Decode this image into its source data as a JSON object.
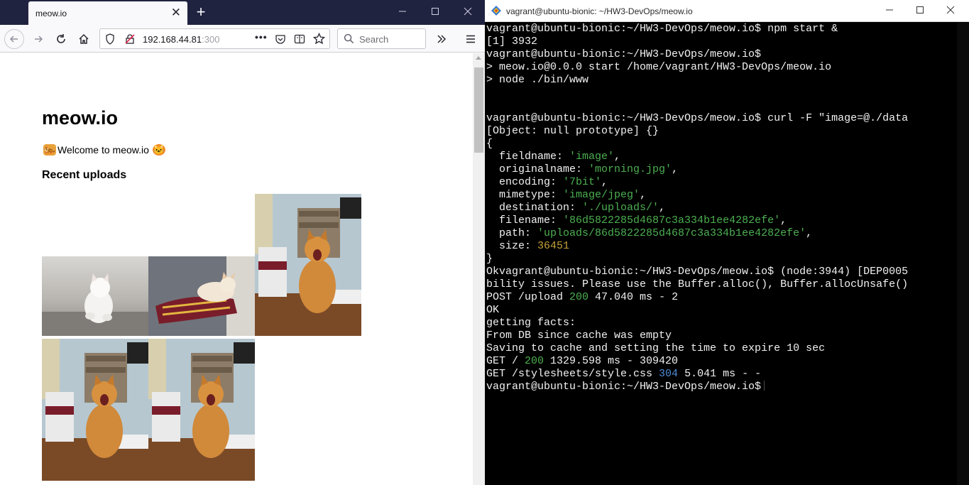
{
  "browser": {
    "tab_title": "meow.io",
    "tab_close": "✕",
    "new_tab": "+",
    "url_host": "192.168.44.81",
    "url_port": ":300",
    "search_placeholder": "Search",
    "page": {
      "title": "meow.io",
      "welcome": "Welcome to meow.io",
      "recent_heading": "Recent uploads"
    }
  },
  "terminal": {
    "window_title": "vagrant@ubuntu-bionic: ~/HW3-DevOps/meow.io",
    "lines": [
      [
        {
          "t": "vagrant@ubuntu-bionic:~/HW3-DevOps/meow.io$ npm start &"
        }
      ],
      [
        {
          "t": "[1] 3932"
        }
      ],
      [
        {
          "t": "vagrant@ubuntu-bionic:~/HW3-DevOps/meow.io$"
        }
      ],
      [
        {
          "t": "> meow.io@0.0.0 start /home/vagrant/HW3-DevOps/meow.io"
        }
      ],
      [
        {
          "t": "> node ./bin/www"
        }
      ],
      [
        {
          "t": ""
        }
      ],
      [
        {
          "t": ""
        }
      ],
      [
        {
          "t": "vagrant@ubuntu-bionic:~/HW3-DevOps/meow.io$ curl -F \"image=@./data"
        }
      ],
      [
        {
          "t": "[Object: null prototype] {}"
        }
      ],
      [
        {
          "t": "{"
        }
      ],
      [
        {
          "t": "  fieldname: "
        },
        {
          "t": "'image'",
          "c": "g"
        },
        {
          "t": ","
        }
      ],
      [
        {
          "t": "  originalname: "
        },
        {
          "t": "'morning.jpg'",
          "c": "g"
        },
        {
          "t": ","
        }
      ],
      [
        {
          "t": "  encoding: "
        },
        {
          "t": "'7bit'",
          "c": "g"
        },
        {
          "t": ","
        }
      ],
      [
        {
          "t": "  mimetype: "
        },
        {
          "t": "'image/jpeg'",
          "c": "g"
        },
        {
          "t": ","
        }
      ],
      [
        {
          "t": "  destination: "
        },
        {
          "t": "'./uploads/'",
          "c": "g"
        },
        {
          "t": ","
        }
      ],
      [
        {
          "t": "  filename: "
        },
        {
          "t": "'86d5822285d4687c3a334b1ee4282efe'",
          "c": "g"
        },
        {
          "t": ","
        }
      ],
      [
        {
          "t": "  path: "
        },
        {
          "t": "'uploads/86d5822285d4687c3a334b1ee4282efe'",
          "c": "g"
        },
        {
          "t": ","
        }
      ],
      [
        {
          "t": "  size: "
        },
        {
          "t": "36451",
          "c": "y"
        }
      ],
      [
        {
          "t": "}"
        }
      ],
      [
        {
          "t": "Okvagrant@ubuntu-bionic:~/HW3-DevOps/meow.io$ (node:3944) [DEP0005"
        }
      ],
      [
        {
          "t": "bility issues. Please use the Buffer.alloc(), Buffer.allocUnsafe()"
        }
      ],
      [
        {
          "t": "POST /upload "
        },
        {
          "t": "200",
          "c": "g"
        },
        {
          "t": " 47.040 ms - 2"
        }
      ],
      [
        {
          "t": "OK"
        }
      ],
      [
        {
          "t": "getting facts:"
        }
      ],
      [
        {
          "t": "From DB since cache was empty"
        }
      ],
      [
        {
          "t": "Saving to cache and setting the time to expire 10 sec"
        }
      ],
      [
        {
          "t": "GET / "
        },
        {
          "t": "200",
          "c": "g"
        },
        {
          "t": " 1329.598 ms - 309420"
        }
      ],
      [
        {
          "t": "GET /stylesheets/style.css "
        },
        {
          "t": "304",
          "c": "b"
        },
        {
          "t": " 5.041 ms - -"
        }
      ],
      [
        {
          "t": "vagrant@ubuntu-bionic:~/HW3-DevOps/meow.io$",
          "cursor": true
        }
      ]
    ]
  },
  "colors": {
    "tabbar": "#202340",
    "terminal_bg": "#000000",
    "terminal_green": "#4caf50",
    "terminal_yellow": "#c5a23a",
    "terminal_blue": "#4f8cd6"
  }
}
